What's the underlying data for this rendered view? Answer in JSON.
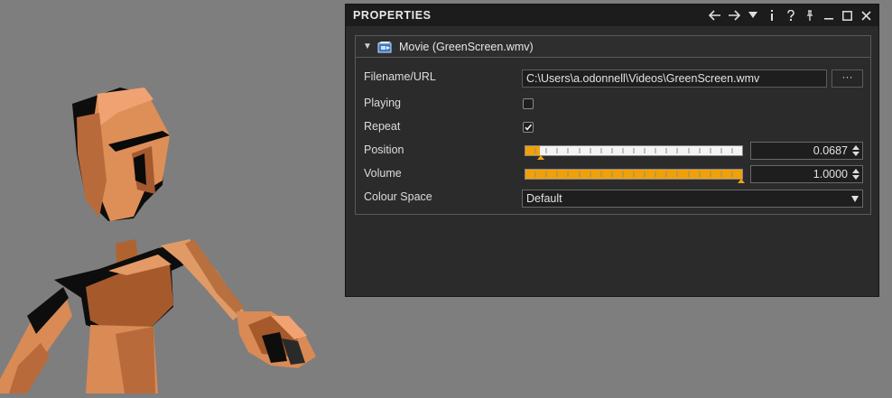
{
  "panel": {
    "title": "PROPERTIES",
    "toolbar": [
      {
        "icon": "arrow-left-icon",
        "glyph": "←"
      },
      {
        "icon": "arrow-right-icon",
        "glyph": "→"
      },
      {
        "icon": "dropdown-icon",
        "glyph": "▼"
      },
      {
        "icon": "info-icon",
        "glyph": "i"
      },
      {
        "icon": "help-icon",
        "glyph": "?"
      },
      {
        "icon": "pin-icon",
        "glyph": ""
      },
      {
        "icon": "minimize-icon",
        "glyph": ""
      },
      {
        "icon": "maximize-icon",
        "glyph": ""
      },
      {
        "icon": "close-icon",
        "glyph": ""
      }
    ]
  },
  "movie": {
    "title": "Movie (GreenScreen.wmv)",
    "filename_label": "Filename/URL",
    "filename_value": "C:\\Users\\a.odonnell\\Videos\\GreenScreen.wmv",
    "browse_label": "···",
    "playing_label": "Playing",
    "playing": false,
    "repeat_label": "Repeat",
    "repeat": true,
    "position_label": "Position",
    "position_value": "0.0687",
    "position_fraction": 0.0687,
    "volume_label": "Volume",
    "volume_value": "1.0000",
    "volume_fraction": 1.0,
    "colour_space_label": "Colour Space",
    "colour_space_value": "Default"
  },
  "colors": {
    "accent": "#f0a10a",
    "panel_bg": "#2b2b2b",
    "viewport_bg": "#7e7e7e",
    "figure_skin": "#d98a55"
  }
}
